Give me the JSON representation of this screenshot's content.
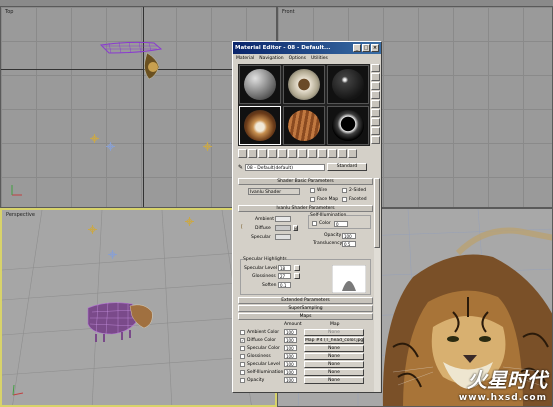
{
  "viewports": {
    "top_label": "Top",
    "front_label": "Front",
    "perspective_label": "Perspective"
  },
  "material_editor": {
    "title": "Material Editor - 08 - Default...",
    "menu": [
      "Material",
      "Navigation",
      "Options",
      "Utilities"
    ],
    "material_name": "08 - Default(default)",
    "material_type": "Standard",
    "shader_basic": {
      "rollout": "Shader Basic Parameters",
      "shader": "Ivanlu Shader",
      "wire": "Wire",
      "two_sided": "2-Sided",
      "face_map": "Face Map",
      "faceted": "Faceted"
    },
    "shader_params": {
      "rollout": "Ivanlu Shader Parameters",
      "self_illum": "Self-Illumination",
      "color": "Color",
      "color_value": "0",
      "ambient": "Ambient",
      "diffuse": "Diffuse",
      "specular": "Specular",
      "opacity": "Opacity",
      "opacity_value": "100",
      "translucency": "Translucency",
      "translucency_value": "0.5"
    },
    "highlights": {
      "title": "Specular Highlights",
      "spec_level": "Specular Level",
      "spec_level_value": "18",
      "glossiness": "Glossiness",
      "glossiness_value": "27",
      "soften": "Soften",
      "soften_value": "0.1"
    },
    "rollouts": {
      "extended": "Extended Parameters",
      "supersampling": "SuperSampling",
      "maps": "Maps"
    },
    "maps": {
      "amount_header": "Amount",
      "map_header": "Map",
      "rows": [
        {
          "label": "Ambient Color",
          "amount": "100",
          "map": "None",
          "checked": false
        },
        {
          "label": "Diffuse Color",
          "amount": "100",
          "map": "Map #4 (T_head_color.jpg)",
          "checked": true
        },
        {
          "label": "Specular Color",
          "amount": "100",
          "map": "None",
          "checked": false
        },
        {
          "label": "Glossiness",
          "amount": "100",
          "map": "None",
          "checked": false
        },
        {
          "label": "Specular Level",
          "amount": "100",
          "map": "None",
          "checked": false
        },
        {
          "label": "Self-Illumination",
          "amount": "100",
          "map": "None",
          "checked": false
        },
        {
          "label": "Opacity",
          "amount": "100",
          "map": "None",
          "checked": false
        }
      ]
    }
  },
  "watermark": {
    "brand": "火星时代",
    "url": "www.hxsd.com"
  }
}
